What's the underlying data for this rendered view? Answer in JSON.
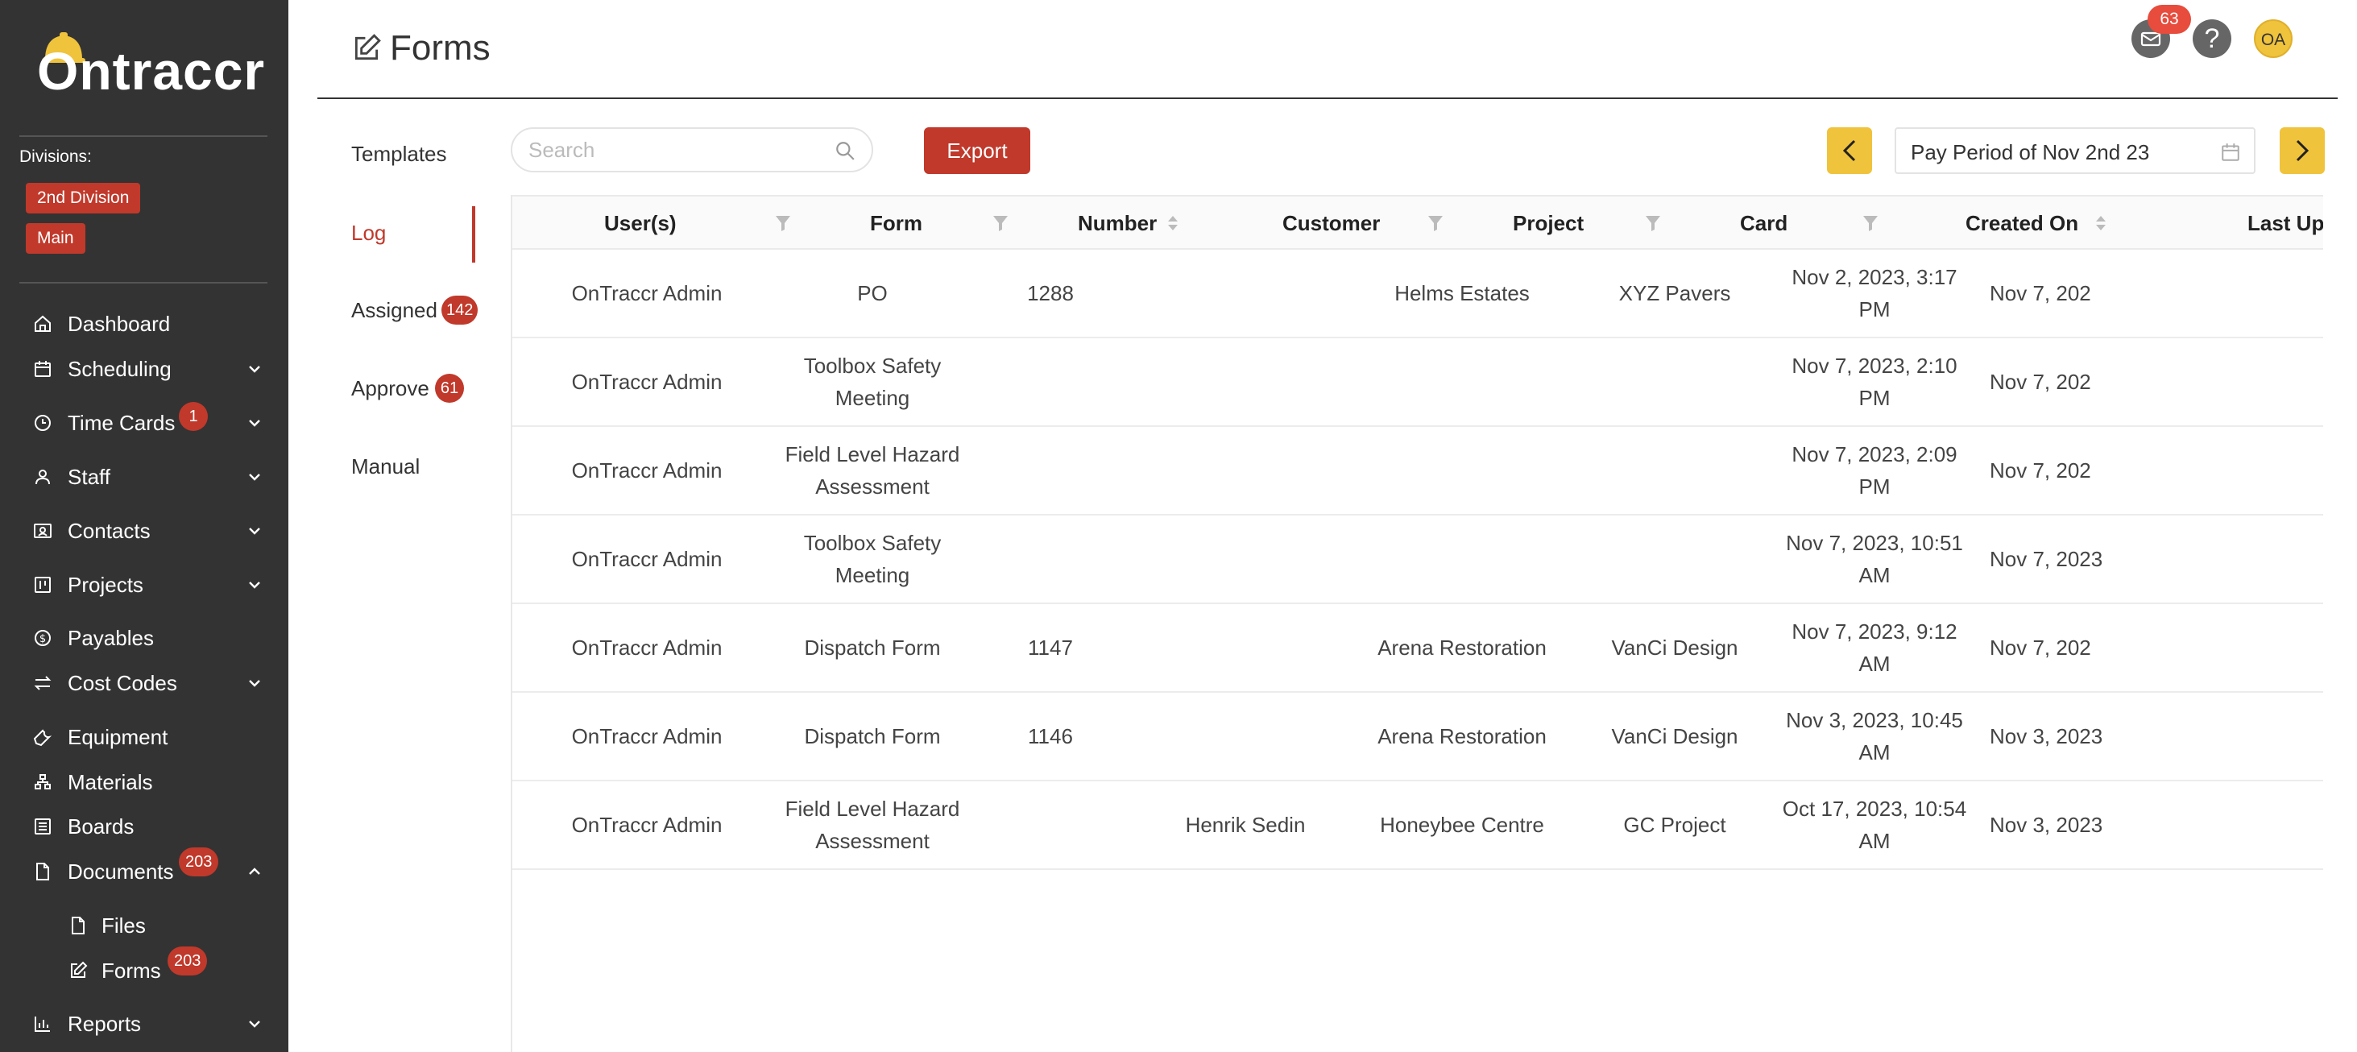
{
  "app": {
    "brand": "Ontraccr",
    "divisions_label": "Divisions:",
    "divisions": [
      "2nd Division",
      "Main"
    ]
  },
  "sidebar": {
    "items": [
      {
        "label": "Dashboard",
        "icon": "home-icon"
      },
      {
        "label": "Scheduling",
        "icon": "calendar-icon",
        "expandable": true
      },
      {
        "label": "Time Cards",
        "icon": "clock-icon",
        "expandable": true,
        "badge": "1"
      },
      {
        "label": "Staff",
        "icon": "user-icon",
        "expandable": true
      },
      {
        "label": "Contacts",
        "icon": "contacts-icon",
        "expandable": true
      },
      {
        "label": "Projects",
        "icon": "projects-icon",
        "expandable": true
      },
      {
        "label": "Payables",
        "icon": "dollar-icon"
      },
      {
        "label": "Cost Codes",
        "icon": "swap-icon",
        "expandable": true
      },
      {
        "label": "Equipment",
        "icon": "wrench-icon"
      },
      {
        "label": "Materials",
        "icon": "materials-icon"
      },
      {
        "label": "Boards",
        "icon": "boards-icon"
      },
      {
        "label": "Documents",
        "icon": "document-icon",
        "expandable": true,
        "expanded": true,
        "badge": "203"
      },
      {
        "label": "Files",
        "icon": "file-icon",
        "sub": true
      },
      {
        "label": "Forms",
        "icon": "edit-icon",
        "sub": true,
        "badge": "203"
      },
      {
        "label": "Reports",
        "icon": "chart-icon",
        "expandable": true
      }
    ]
  },
  "header": {
    "title": "Forms",
    "mail_badge": "63",
    "help": "?",
    "avatar": "OA"
  },
  "subnav": {
    "items": [
      {
        "label": "Templates"
      },
      {
        "label": "Log",
        "active": true
      },
      {
        "label": "Assigned",
        "badge": "142"
      },
      {
        "label": "Approve",
        "badge": "61"
      },
      {
        "label": "Manual"
      }
    ]
  },
  "toolbar": {
    "search_placeholder": "Search",
    "export_label": "Export",
    "period": "Pay Period of Nov 2nd 23"
  },
  "table": {
    "columns": [
      "User(s)",
      "Form",
      "Number",
      "Customer",
      "Project",
      "Card",
      "Created On",
      "Last Upd"
    ],
    "rows": [
      [
        "OnTraccr Admin",
        "PO",
        "1288",
        "",
        "Helms Estates",
        "XYZ Pavers",
        "Nov 2, 2023, 3:17 PM",
        "Nov 7, 202"
      ],
      [
        "OnTraccr Admin",
        "Toolbox Safety Meeting",
        "",
        "",
        "",
        "",
        "Nov 7, 2023, 2:10 PM",
        "Nov 7, 202"
      ],
      [
        "OnTraccr Admin",
        "Field Level Hazard Assessment",
        "",
        "",
        "",
        "",
        "Nov 7, 2023, 2:09 PM",
        "Nov 7, 202"
      ],
      [
        "OnTraccr Admin",
        "Toolbox Safety Meeting",
        "",
        "",
        "",
        "",
        "Nov 7, 2023, 10:51 AM",
        "Nov 7, 2023"
      ],
      [
        "OnTraccr Admin",
        "Dispatch Form",
        "1147",
        "",
        "Arena Restoration",
        "VanCi Design",
        "Nov 7, 2023, 9:12 AM",
        "Nov 7, 202"
      ],
      [
        "OnTraccr Admin",
        "Dispatch Form",
        "1146",
        "",
        "Arena Restoration",
        "VanCi Design",
        "Nov 3, 2023, 10:45 AM",
        "Nov 3, 2023"
      ],
      [
        "OnTraccr Admin",
        "Field Level Hazard Assessment",
        "",
        "Henrik Sedin",
        "Honeybee Centre",
        "GC Project",
        "Oct 17, 2023, 10:54 AM",
        "Nov 3, 2023"
      ]
    ]
  },
  "colors": {
    "sidebar_bg": "#333333",
    "accent_red": "#c0392b",
    "accent_yellow": "#f0c33c"
  }
}
